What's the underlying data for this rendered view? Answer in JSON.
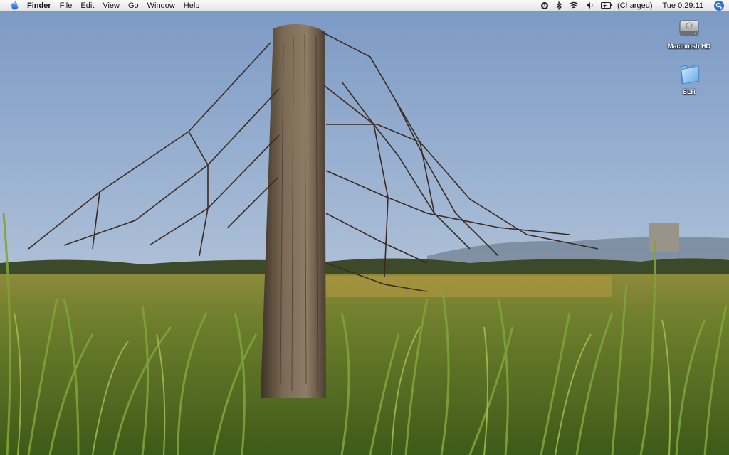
{
  "menubar": {
    "apple_icon": "apple-logo-icon",
    "app_name": "Finder",
    "menus": [
      "File",
      "Edit",
      "View",
      "Go",
      "Window",
      "Help"
    ],
    "status_icons": [
      "time-machine-icon",
      "bluetooth-icon",
      "wifi-icon",
      "volume-icon",
      "battery-icon"
    ],
    "battery_status": "(Charged)",
    "clock": "Tue 0:29:11",
    "spotlight_icon": "spotlight-search-icon"
  },
  "desktop": {
    "wallpaper": "fence post and barbed wire in a grass field under blue sky",
    "icons": [
      {
        "label": "Macintosh HD",
        "icon": "hard-drive-icon"
      },
      {
        "label": "SLR",
        "icon": "folder-icon"
      }
    ]
  },
  "colors": {
    "sky_top": "#7d9bc6",
    "sky_bottom": "#cfd9e2",
    "grass": "#5d7a2a",
    "post": "#6b5a47",
    "menubar": "#f2f2f2",
    "spotlight": "#2f6fd8"
  }
}
